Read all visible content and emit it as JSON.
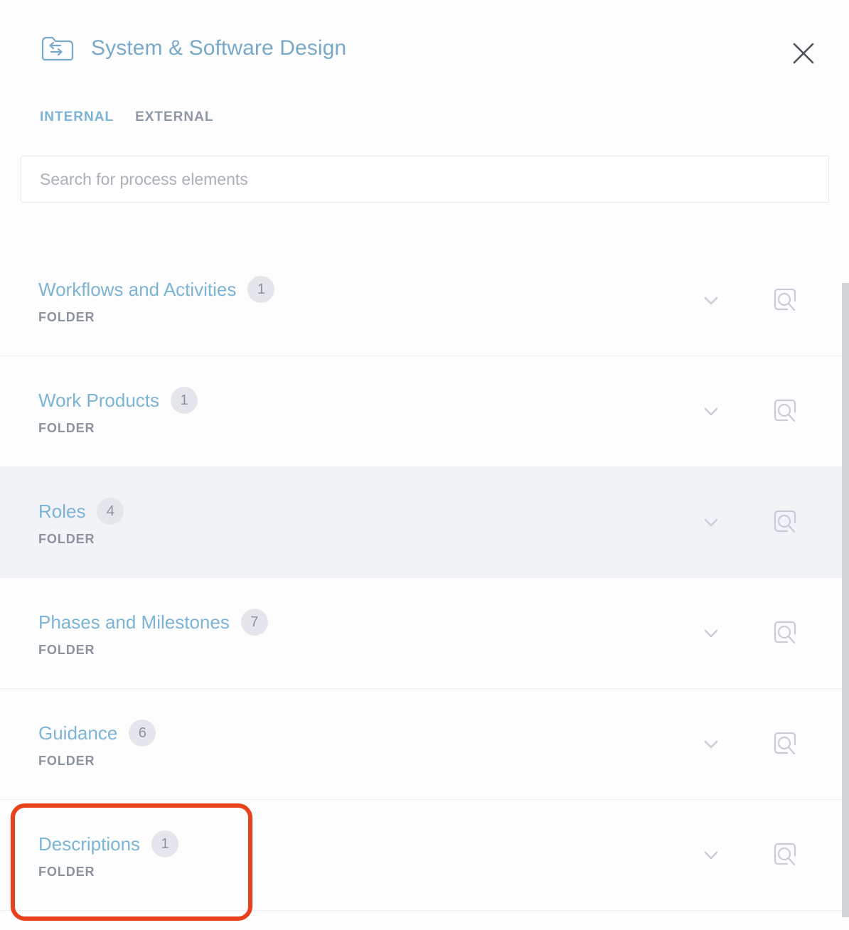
{
  "header": {
    "title": "System & Software Design",
    "icon": "folder-exchange-icon",
    "close_icon": "close-icon",
    "accent_color": "#7cb4d6"
  },
  "tabs": [
    {
      "label": "INTERNAL",
      "active": true
    },
    {
      "label": "EXTERNAL",
      "active": false
    }
  ],
  "search": {
    "placeholder": "Search for process elements",
    "value": ""
  },
  "list": {
    "type_label": "FOLDER",
    "expand_icon": "chevron-down-icon",
    "preview_icon": "preview-search-icon",
    "rows": [
      {
        "title": "Workflows and Activities",
        "count": "1",
        "type": "FOLDER",
        "selected": false
      },
      {
        "title": "Work Products",
        "count": "1",
        "type": "FOLDER",
        "selected": false
      },
      {
        "title": "Roles",
        "count": "4",
        "type": "FOLDER",
        "selected": true
      },
      {
        "title": "Phases and Milestones",
        "count": "7",
        "type": "FOLDER",
        "selected": false
      },
      {
        "title": "Guidance",
        "count": "6",
        "type": "FOLDER",
        "selected": false
      },
      {
        "title": "Descriptions",
        "count": "1",
        "type": "FOLDER",
        "selected": false
      }
    ]
  },
  "annotation": {
    "target": "Descriptions",
    "color": "#e8421d"
  },
  "colors": {
    "background": "#fdfdfd",
    "row_selected": "#f1f3f7",
    "link": "#7cb4d6",
    "muted": "#8b939f",
    "badge_bg": "#e4e6eb",
    "scrollbar": "#d4d5d7"
  }
}
